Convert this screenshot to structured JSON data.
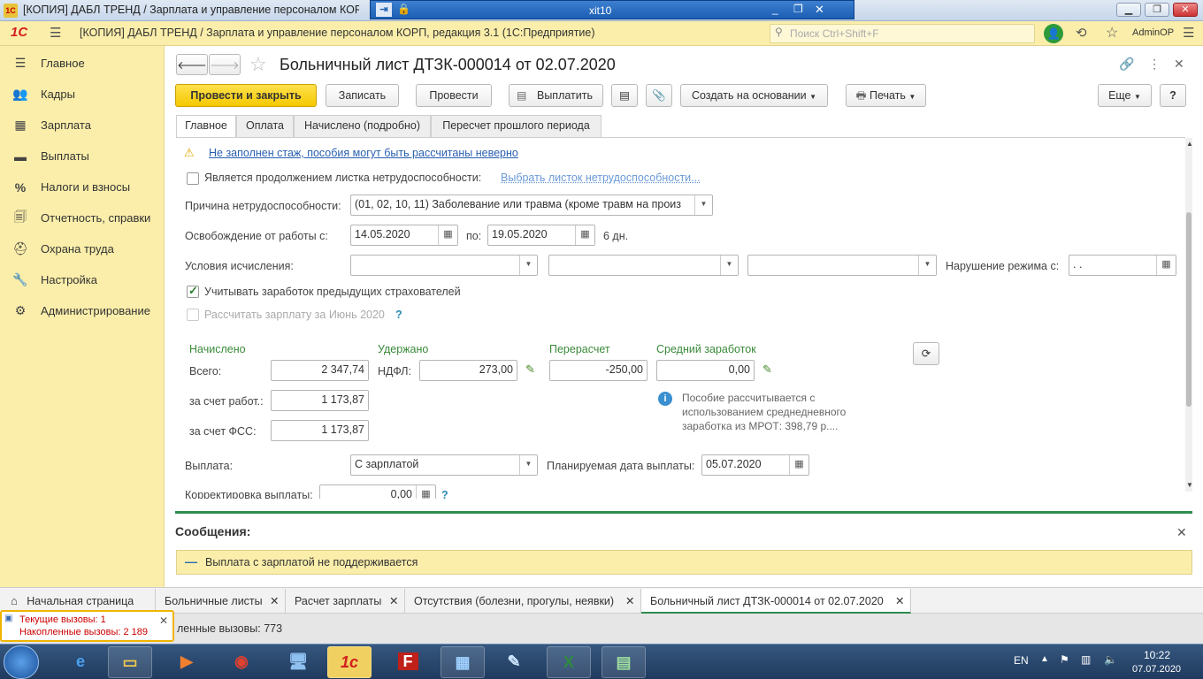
{
  "window": {
    "title": "[КОПИЯ] ДАБЛ ТРЕНД / Зарплата и управление персоналом КОРП, р",
    "rdp_title": "xit10"
  },
  "app": {
    "logo": "1С",
    "title": "[КОПИЯ] ДАБЛ ТРЕНД / Зарплата и управление персоналом КОРП, редакция 3.1  (1С:Предприятие)",
    "search_placeholder": "Поиск Ctrl+Shift+F",
    "user": "AdminOP"
  },
  "sidebar": {
    "items": [
      {
        "label": "Главное",
        "icon": "hamburger-icon"
      },
      {
        "label": "Кадры",
        "icon": "people-icon"
      },
      {
        "label": "Зарплата",
        "icon": "calculator-icon"
      },
      {
        "label": "Выплаты",
        "icon": "wallet-icon"
      },
      {
        "label": "Налоги и взносы",
        "icon": "percent-icon"
      },
      {
        "label": "Отчетность, справки",
        "icon": "report-icon"
      },
      {
        "label": "Охрана труда",
        "icon": "helmet-icon"
      },
      {
        "label": "Настройка",
        "icon": "wrench-icon"
      },
      {
        "label": "Администрирование",
        "icon": "gear-icon"
      }
    ]
  },
  "document": {
    "title": "Больничный лист ДТЗК-000014 от 02.07.2020",
    "toolbar": {
      "post_close": "Провести и закрыть",
      "save": "Записать",
      "post": "Провести",
      "pay": "Выплатить",
      "create_based": "Создать на основании",
      "print": "Печать",
      "more": "Еще",
      "help": "?"
    },
    "tabs": [
      "Главное",
      "Оплата",
      "Начислено (подробно)",
      "Пересчет прошлого периода"
    ],
    "warning": "Не заполнен стаж, пособия могут быть рассчитаны неверно",
    "continuation_label": "Является продолжением листка нетрудоспособности:",
    "continuation_link": "Выбрать листок нетрудоспособности...",
    "reason_label": "Причина нетрудоспособности:",
    "reason_value": "(01, 02, 10, 11) Заболевание или травма (кроме травм на произ",
    "release_label": "Освобождение от работы с:",
    "release_from": "14.05.2020",
    "release_to_label": "по:",
    "release_to": "19.05.2020",
    "days": "6 дн.",
    "conditions_label": "Условия исчисления:",
    "violation_label": "Нарушение режима с:",
    "violation_value": " .  .",
    "prev_insurers_label": "Учитывать заработок предыдущих страхователей",
    "prev_insurers_checked": true,
    "calc_salary_label": "Рассчитать зарплату за Июнь 2020",
    "calc_salary_q": "?",
    "accrued_header": "Начислено",
    "withheld_header": "Удержано",
    "recalc_header": "Перерасчет",
    "avg_header": "Средний заработок",
    "total_label": "Всего:",
    "total_value": "2 347,74",
    "ndfl_label": "НДФЛ:",
    "ndfl_value": "273,00",
    "recalc_value": "-250,00",
    "avg_value": "0,00",
    "employer_label": "за счет работ.:",
    "employer_value": "1 173,87",
    "fss_label": "за счет ФСС:",
    "fss_value": "1 173,87",
    "info_text": "Пособие рассчитывается с использованием среднедневного заработка из МРОТ: 398,79 р....",
    "payment_label": "Выплата:",
    "payment_value": "С зарплатой",
    "plan_date_label": "Планируемая дата выплаты:",
    "plan_date_value": "05.07.2020",
    "correction_label": "Корректировка выплаты:",
    "correction_value": "0,00",
    "correction_q": "?"
  },
  "messages": {
    "title": "Сообщения:",
    "items": [
      "Выплата с зарплатой не поддерживается"
    ]
  },
  "bottom_tabs": [
    "Начальная страница",
    "Больничные листы",
    "Расчет зарплаты",
    "Отсутствия (болезни, прогулы, неявки)",
    "Больничный лист ДТЗК-000014 от 02.07.2020"
  ],
  "status": {
    "current_calls": "Текущие вызовы: 1",
    "accumulated_calls": "Накопленные вызовы: 2 189",
    "behind_text": "ленные вызовы: 773"
  },
  "taskbar": {
    "lang": "EN",
    "time": "10:22",
    "date": "07.07.2020"
  }
}
